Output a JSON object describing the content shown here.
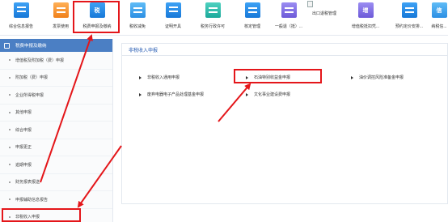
{
  "toolbar": {
    "items": [
      {
        "label": "综合信息报告",
        "icon": "document-check-icon",
        "color": "blue"
      },
      {
        "label": "发票使用",
        "icon": "invoice-icon",
        "color": "orange"
      },
      {
        "label": "税费申报及缴纳",
        "icon": "tax-declare-icon",
        "color": "blue",
        "glyph": "税"
      },
      {
        "label": "税收减免",
        "icon": "reduce-icon",
        "color": "lightblue"
      },
      {
        "label": "证明开具",
        "icon": "certificate-icon",
        "color": "blue"
      },
      {
        "label": "税务行政许可",
        "icon": "license-icon",
        "color": "teal"
      },
      {
        "label": "核定管理",
        "icon": "approve-icon",
        "color": "blue"
      },
      {
        "label": "一般退（抵）...",
        "icon": "refund-icon",
        "color": "purple"
      },
      {
        "label": "出口退税管理",
        "icon": "export-refund-icon",
        "broken": true
      },
      {
        "label": "增值税抵扣凭...",
        "icon": "vat-deduct-icon",
        "color": "purple",
        "glyph": "增"
      },
      {
        "label": "预约定价安排...",
        "icon": "pricing-icon",
        "color": "blue"
      },
      {
        "label": "纳税信...",
        "icon": "credit-icon",
        "color": "lightblue",
        "glyph": "信"
      }
    ]
  },
  "sidebar": {
    "header": "税费申报及缴纳",
    "items": [
      {
        "label": "增值税及附加税（费）申报"
      },
      {
        "label": "附加税（费）申报"
      },
      {
        "label": "企业所得税申报"
      },
      {
        "label": "其他申报"
      },
      {
        "label": "综合申报"
      },
      {
        "label": "申报更正"
      },
      {
        "label": "逾期申报"
      },
      {
        "label": "财务报表报送"
      },
      {
        "label": "申报辅助信息报告"
      },
      {
        "label": "非税收入申报"
      }
    ]
  },
  "main": {
    "title": "非税收入申报",
    "links": [
      {
        "label": "非税收入通用申报"
      },
      {
        "label": "石油特别收益金申报"
      },
      {
        "label": "油价调控风险准备金申报"
      },
      {
        "label": "废弃电器电子产品处理基金申报"
      },
      {
        "label": "文化事业建设费申报"
      }
    ]
  },
  "colors": {
    "highlight": "#e4161a",
    "sidebar_header": "#4b7fc4",
    "panel_title": "#2b5fb5"
  }
}
